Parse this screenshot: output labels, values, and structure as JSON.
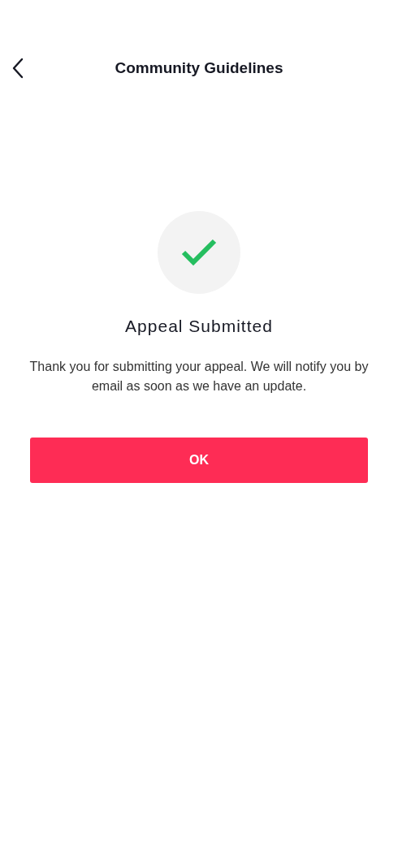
{
  "header": {
    "title": "Community Guidelines"
  },
  "status": {
    "title": "Appeal Submitted",
    "message": "Thank you for submitting your appeal. We will notify you by email as soon as we have an update."
  },
  "buttons": [
    "OK"
  ]
}
